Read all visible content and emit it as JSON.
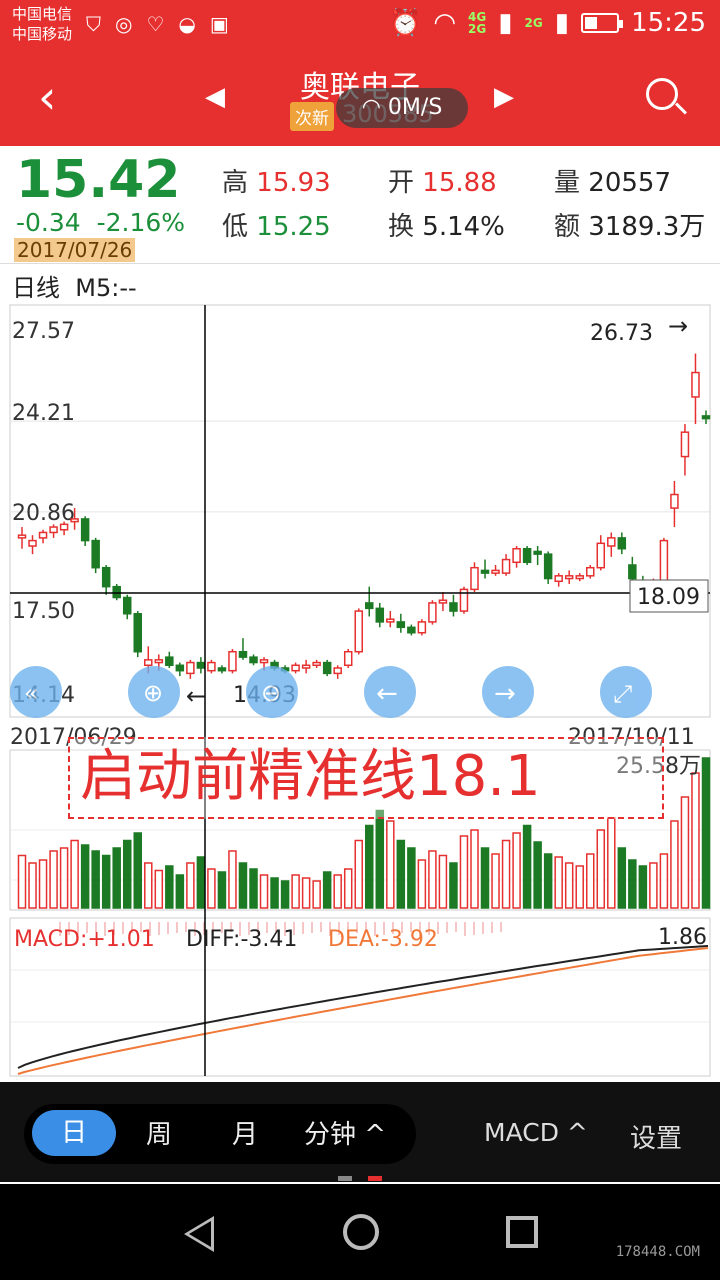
{
  "status": {
    "carrier1": "中国电信",
    "carrier2": "中国移动",
    "net1": "4G",
    "net2": "2G",
    "net3": "2G",
    "time": "15:25"
  },
  "header": {
    "title": "奥联电子",
    "tag": "次新",
    "code": "300585",
    "speed": "0M/S"
  },
  "quote": {
    "price": "15.42",
    "change": "-0.34",
    "change_pct": "-2.16%",
    "date": "2017/07/26",
    "high_label": "高",
    "high": "15.93",
    "low_label": "低",
    "low": "15.25",
    "open_label": "开",
    "open": "15.88",
    "turnover_label": "换",
    "turnover": "5.14%",
    "volume_label": "量",
    "volume": "20557",
    "amount_label": "额",
    "amount": "3189.3万"
  },
  "period": {
    "label": "日线",
    "ma": "M5:--"
  },
  "chart_data": {
    "type": "candlestick",
    "y_ticks": [
      "27.57",
      "24.21",
      "20.86",
      "17.50",
      "14.14"
    ],
    "ylim": [
      14.14,
      27.57
    ],
    "x_start": "2017/06/29",
    "x_end": "2017/10/11",
    "crosshair_price": "18.09",
    "high_annotation": "26.73",
    "low_annotation": "14.93",
    "volume_max": "25.58万",
    "macd_label": "MACD:+1.01",
    "diff_label": "DIFF:-3.41",
    "dea_label": "DEA:-3.92",
    "macd_right": "1.86",
    "candles": [
      [
        19.9,
        20.3,
        19.5,
        20.0
      ],
      [
        19.6,
        20.0,
        19.3,
        19.8
      ],
      [
        19.9,
        20.2,
        19.7,
        20.1
      ],
      [
        20.1,
        20.4,
        19.9,
        20.3
      ],
      [
        20.2,
        20.5,
        20.0,
        20.4
      ],
      [
        20.5,
        21.0,
        20.2,
        20.6
      ],
      [
        20.6,
        20.7,
        19.6,
        19.8
      ],
      [
        19.8,
        19.9,
        18.6,
        18.8
      ],
      [
        18.8,
        18.9,
        17.8,
        18.1
      ],
      [
        18.1,
        18.2,
        17.6,
        17.7
      ],
      [
        17.7,
        17.8,
        16.9,
        17.1
      ],
      [
        17.1,
        17.2,
        15.5,
        15.7
      ],
      [
        15.2,
        15.9,
        14.9,
        15.4
      ],
      [
        15.3,
        15.6,
        15.0,
        15.4
      ],
      [
        15.5,
        15.7,
        15.1,
        15.2
      ],
      [
        15.2,
        15.3,
        14.8,
        15.0
      ],
      [
        14.9,
        15.4,
        14.7,
        15.3
      ],
      [
        15.3,
        15.5,
        14.9,
        15.1
      ],
      [
        15.0,
        15.4,
        14.9,
        15.3
      ],
      [
        15.1,
        15.2,
        14.9,
        15.0
      ],
      [
        15.0,
        15.8,
        14.9,
        15.7
      ],
      [
        15.7,
        16.2,
        15.4,
        15.5
      ],
      [
        15.5,
        15.6,
        15.2,
        15.3
      ],
      [
        15.3,
        15.5,
        15.0,
        15.4
      ],
      [
        15.3,
        15.4,
        15.0,
        15.1
      ],
      [
        15.1,
        15.2,
        14.9,
        15.0
      ],
      [
        15.0,
        15.3,
        14.9,
        15.2
      ],
      [
        15.1,
        15.4,
        14.9,
        15.2
      ],
      [
        15.2,
        15.4,
        15.1,
        15.3
      ],
      [
        15.3,
        15.4,
        14.8,
        14.9
      ],
      [
        14.9,
        15.2,
        14.7,
        15.1
      ],
      [
        15.2,
        15.8,
        15.1,
        15.7
      ],
      [
        15.7,
        17.3,
        15.6,
        17.2
      ],
      [
        17.5,
        18.1,
        17.0,
        17.3
      ],
      [
        17.3,
        17.5,
        16.6,
        16.8
      ],
      [
        16.8,
        17.2,
        16.6,
        16.9
      ],
      [
        16.8,
        17.1,
        16.4,
        16.6
      ],
      [
        16.6,
        16.7,
        16.3,
        16.4
      ],
      [
        16.4,
        16.9,
        16.3,
        16.8
      ],
      [
        16.8,
        17.6,
        16.7,
        17.5
      ],
      [
        17.5,
        17.9,
        17.2,
        17.6
      ],
      [
        17.5,
        17.8,
        17.0,
        17.2
      ],
      [
        17.2,
        18.1,
        17.1,
        18.0
      ],
      [
        18.0,
        19.0,
        17.9,
        18.8
      ],
      [
        18.7,
        19.1,
        18.4,
        18.6
      ],
      [
        18.6,
        18.9,
        18.5,
        18.7
      ],
      [
        18.6,
        19.3,
        18.5,
        19.1
      ],
      [
        19.0,
        19.6,
        18.8,
        19.5
      ],
      [
        19.5,
        19.6,
        18.9,
        19.0
      ],
      [
        19.4,
        19.6,
        18.9,
        19.3
      ],
      [
        19.3,
        19.4,
        18.2,
        18.4
      ],
      [
        18.3,
        18.6,
        18.1,
        18.5
      ],
      [
        18.4,
        18.7,
        18.2,
        18.5
      ],
      [
        18.4,
        18.6,
        18.3,
        18.5
      ],
      [
        18.5,
        18.9,
        18.4,
        18.8
      ],
      [
        18.8,
        20.0,
        18.7,
        19.7
      ],
      [
        19.6,
        20.1,
        19.2,
        19.9
      ],
      [
        19.9,
        20.1,
        19.3,
        19.5
      ],
      [
        18.9,
        19.2,
        18.2,
        18.4
      ],
      [
        18.3,
        18.5,
        18.1,
        18.2
      ],
      [
        18.1,
        18.4,
        18.0,
        18.2
      ],
      [
        18.2,
        19.9,
        18.1,
        19.8
      ],
      [
        21.0,
        22.0,
        20.3,
        21.5
      ],
      [
        22.9,
        24.1,
        22.2,
        23.8
      ],
      [
        25.1,
        26.7,
        24.1,
        26.0
      ],
      [
        24.4,
        24.6,
        24.1,
        24.3
      ]
    ],
    "volumes": [
      0.35,
      0.3,
      0.32,
      0.38,
      0.4,
      0.45,
      0.42,
      0.38,
      0.35,
      0.4,
      0.45,
      0.5,
      0.3,
      0.25,
      0.28,
      0.22,
      0.3,
      0.34,
      0.26,
      0.24,
      0.38,
      0.3,
      0.26,
      0.22,
      0.2,
      0.18,
      0.22,
      0.2,
      0.18,
      0.24,
      0.22,
      0.26,
      0.45,
      0.55,
      0.65,
      0.58,
      0.45,
      0.4,
      0.32,
      0.38,
      0.35,
      0.3,
      0.48,
      0.52,
      0.4,
      0.36,
      0.45,
      0.5,
      0.55,
      0.44,
      0.36,
      0.34,
      0.3,
      0.28,
      0.36,
      0.52,
      0.6,
      0.4,
      0.32,
      0.28,
      0.3,
      0.36,
      0.58,
      0.74,
      0.9,
      1.0
    ]
  },
  "toolbar": {
    "tab_day": "日",
    "tab_week": "周",
    "tab_month": "月",
    "tab_minute": "分钟 ^",
    "indicator": "MACD ^",
    "settings": "设置"
  },
  "annotation": "启动前精准线18.1",
  "watermark": "178448.COM",
  "colors": {
    "brand": "#e6302f",
    "up": "#e6302f",
    "down": "#1c7a24",
    "dea": "#f07838"
  }
}
